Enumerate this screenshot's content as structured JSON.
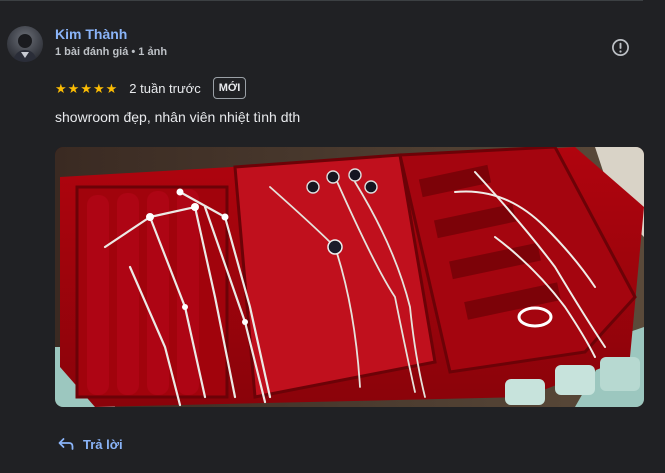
{
  "review": {
    "author": {
      "name": "Kim Thành",
      "meta": "1 bài đánh giá • 1 ảnh",
      "avatar_icon": "user-avatar"
    },
    "rating": {
      "stars": 5,
      "max": 5,
      "star_char": "★"
    },
    "time": "2 tuần trước",
    "badge": "MỚI",
    "text": "showroom đẹp, nhân viên nhiệt tình dth",
    "photo": {
      "icon": "jewelry-photo"
    },
    "more_icon": "report-icon",
    "reply": {
      "label": "Trả lời",
      "icon": "reply-arrow-icon"
    }
  },
  "colors": {
    "background": "#202124",
    "link": "#8ab4f8",
    "star": "#fbbc04",
    "text": "#e8eaed",
    "muted": "#bdc1c6"
  }
}
